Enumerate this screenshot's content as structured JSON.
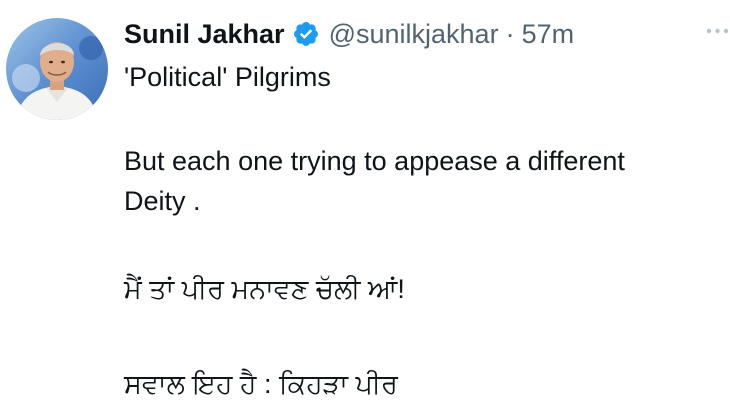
{
  "author": {
    "name": "Sunil Jakhar",
    "handle": "@sunilkjakhar",
    "separator": "·",
    "time": "57m"
  },
  "icons": {
    "verified": "verified-badge-icon",
    "more": "more-horizontal-icon",
    "avatar": "profile-photo"
  },
  "tweet": {
    "lines": [
      "'Political' Pilgrims",
      "But each one trying to appease a different",
      "Deity .",
      "ਮੈਂ ਤਾਂ ਪੀਰ ਮਨਾਵਣ ਚੱਲੀ ਆਂ!",
      "ਸਵਾਲ ਇਹ ਹੈ : ਕਿਹੜਾ ਪੀਰ"
    ]
  },
  "colors": {
    "verified_blue": "#1d9bf0",
    "secondary_text": "#536471",
    "primary_text": "#0f1419"
  }
}
